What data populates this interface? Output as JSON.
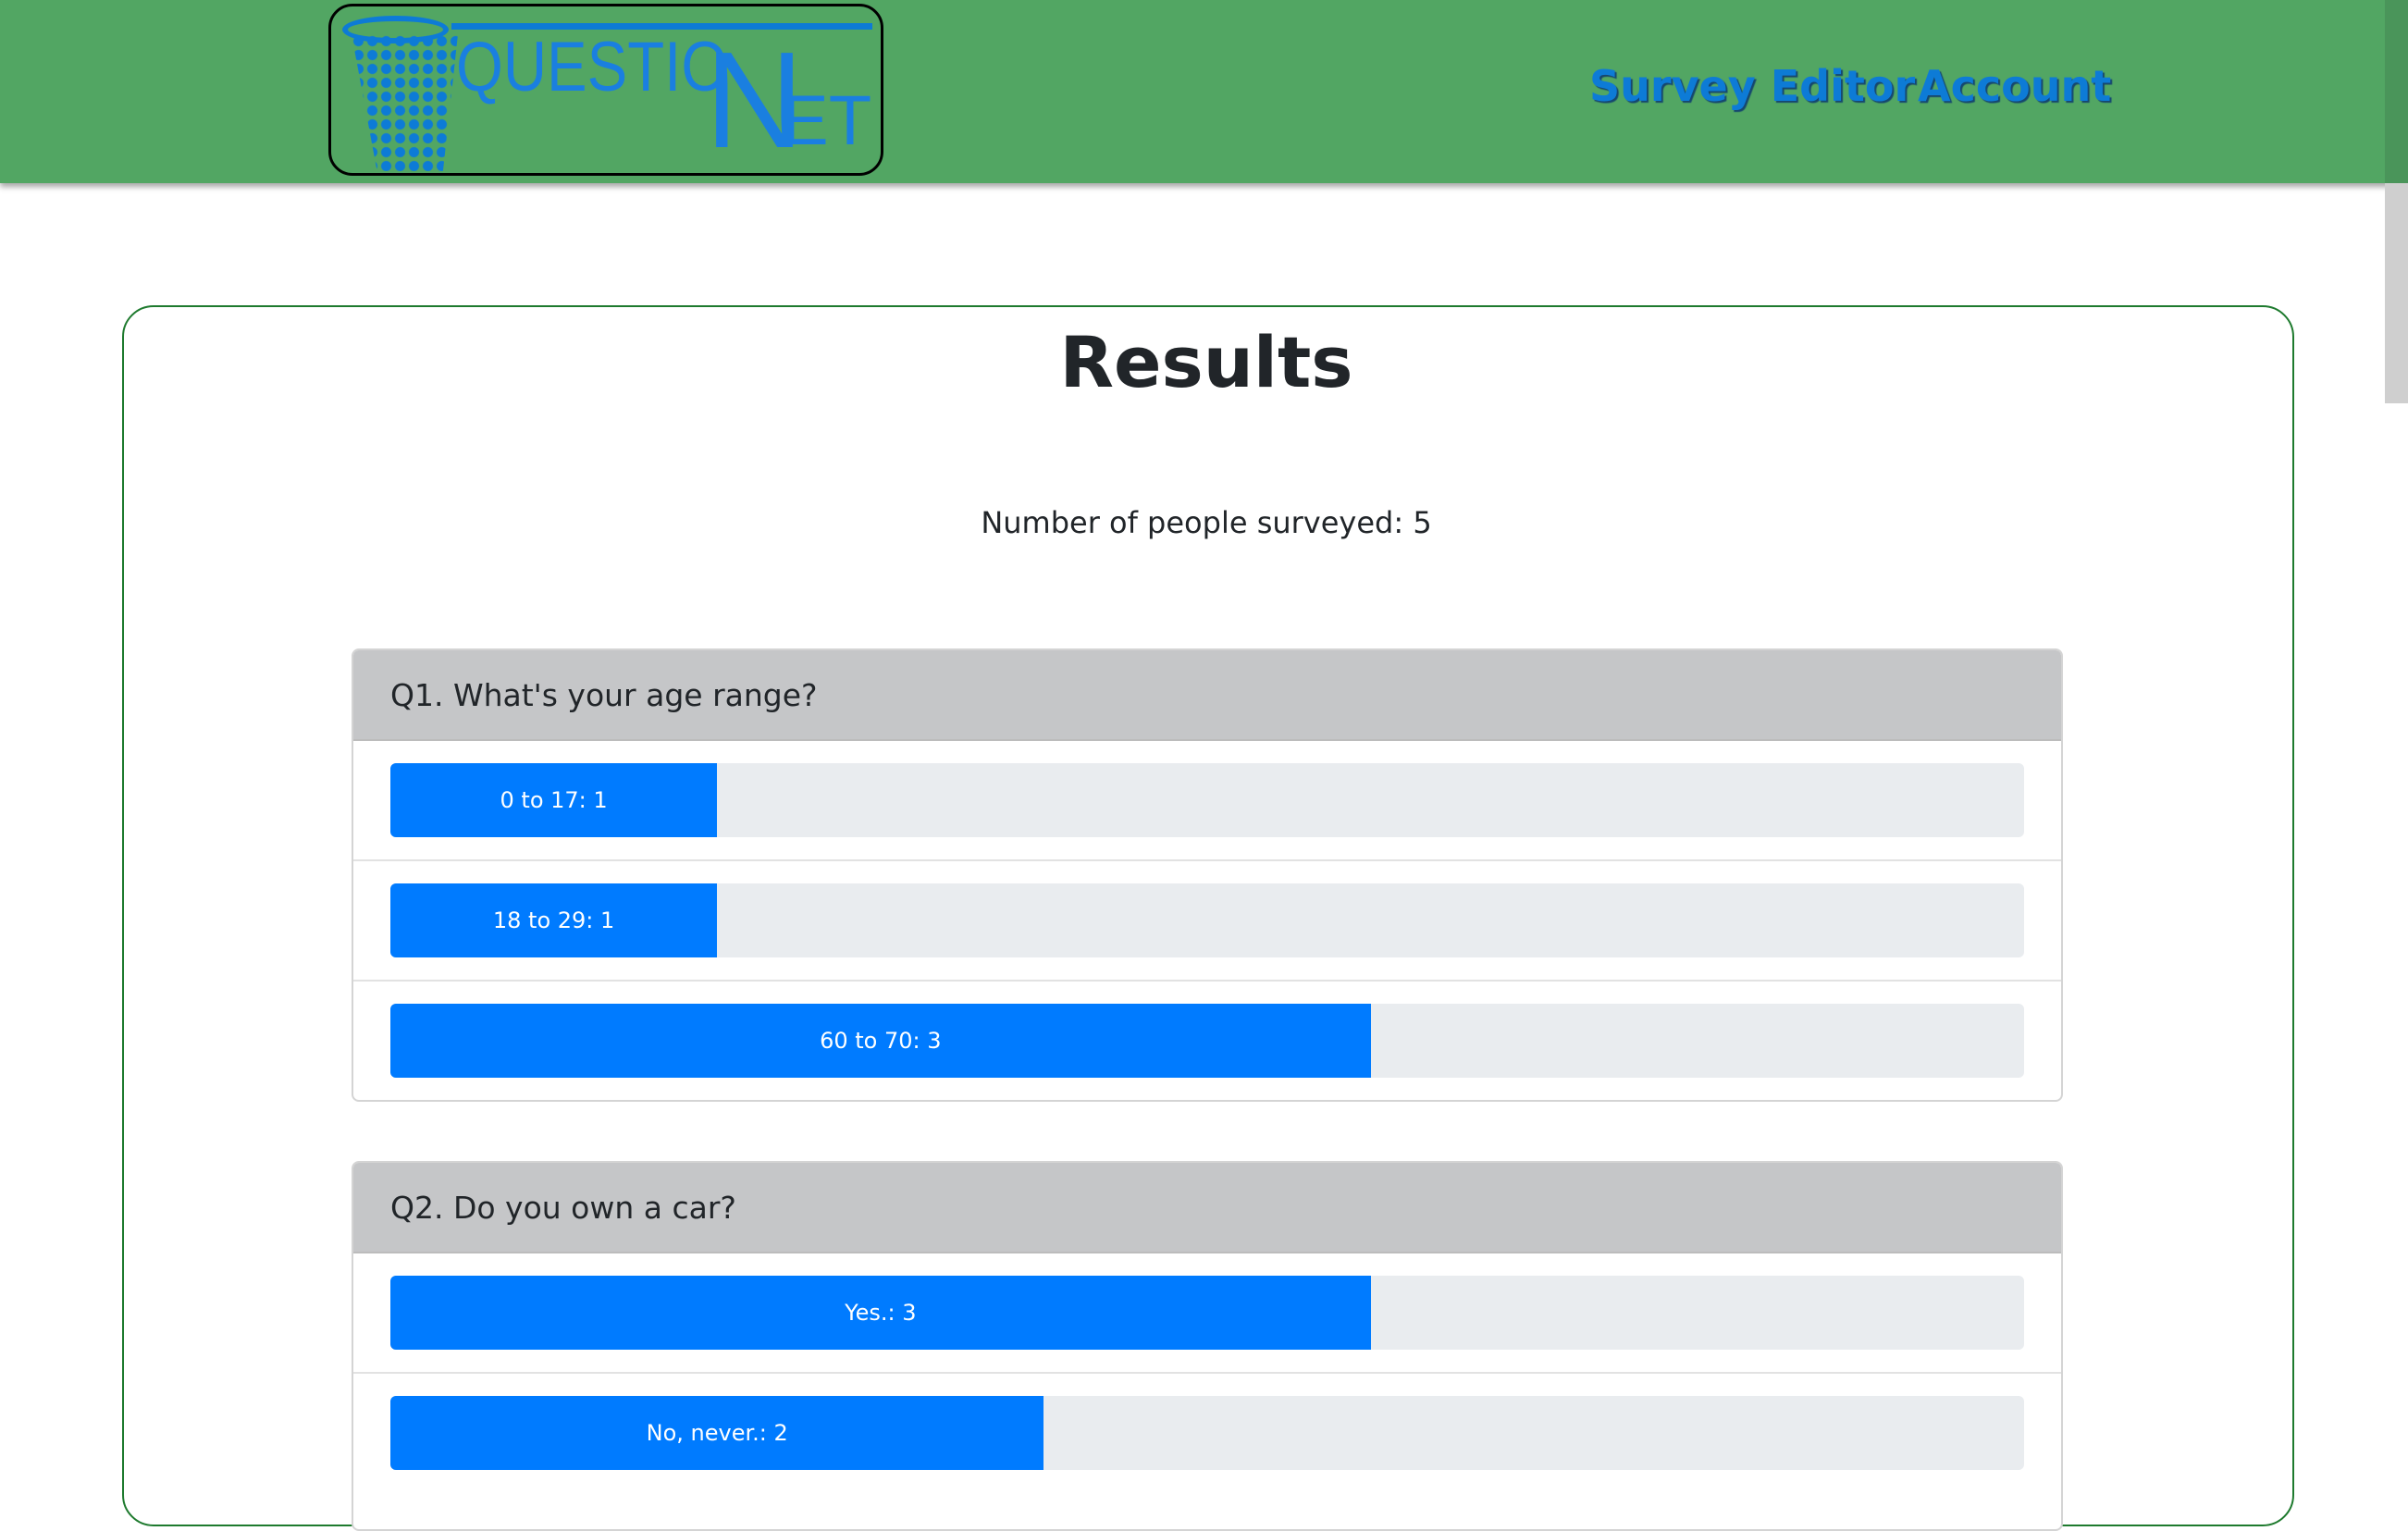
{
  "header": {
    "logo": {
      "text_question": "QUESTIO",
      "text_n": "N",
      "text_et": "ET"
    },
    "nav": [
      {
        "label": "Survey Editor"
      },
      {
        "label": "Account"
      }
    ]
  },
  "results": {
    "title": "Results",
    "surveyed_text": "Number of people surveyed: 5",
    "questions": [
      {
        "title": "Q1. What's your age range?",
        "answers": [
          {
            "label": "0 to 17: 1",
            "fraction": 0.2
          },
          {
            "label": "18 to 29: 1",
            "fraction": 0.2
          },
          {
            "label": "60 to 70: 3",
            "fraction": 0.6
          }
        ]
      },
      {
        "title": "Q2. Do you own a car?",
        "answers": [
          {
            "label": "Yes.: 3",
            "fraction": 0.6
          },
          {
            "label": "No, never.: 2",
            "fraction": 0.4
          }
        ]
      }
    ]
  },
  "colors": {
    "navbar": "#52a663",
    "accent": "#007bff",
    "bar_track": "#e9ecef",
    "card_border": "#1e7a2e"
  }
}
